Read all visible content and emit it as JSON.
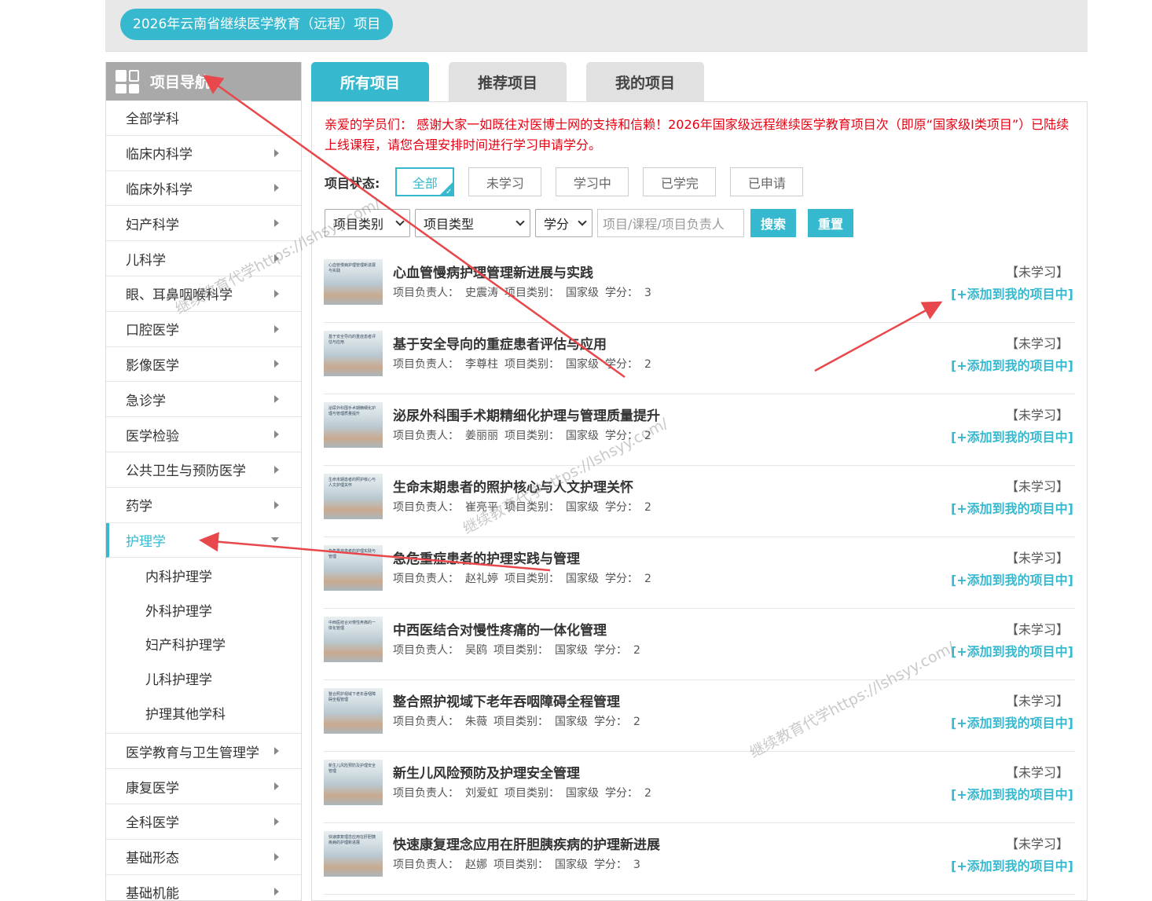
{
  "header": {
    "project_title": "2026年云南省继续医学教育（远程）项目"
  },
  "sidebar": {
    "title": "项目导航",
    "items": [
      {
        "label": "全部学科",
        "arrow": "none"
      },
      {
        "label": "临床内科学",
        "arrow": "right"
      },
      {
        "label": "临床外科学",
        "arrow": "right"
      },
      {
        "label": "妇产科学",
        "arrow": "right"
      },
      {
        "label": "儿科学",
        "arrow": "right"
      },
      {
        "label": "眼、耳鼻咽喉科学",
        "arrow": "right"
      },
      {
        "label": "口腔医学",
        "arrow": "right"
      },
      {
        "label": "影像医学",
        "arrow": "right"
      },
      {
        "label": "急诊学",
        "arrow": "right"
      },
      {
        "label": "医学检验",
        "arrow": "right"
      },
      {
        "label": "公共卫生与预防医学",
        "arrow": "right"
      },
      {
        "label": "药学",
        "arrow": "right"
      },
      {
        "label": "护理学",
        "arrow": "down",
        "active": true
      },
      {
        "label": "医学教育与卫生管理学",
        "arrow": "right"
      },
      {
        "label": "康复医学",
        "arrow": "right"
      },
      {
        "label": "全科医学",
        "arrow": "right"
      },
      {
        "label": "基础形态",
        "arrow": "right"
      },
      {
        "label": "基础机能",
        "arrow": "right"
      }
    ],
    "sub_items": [
      "内科护理学",
      "外科护理学",
      "妇产科护理学",
      "儿科护理学",
      "护理其他学科"
    ]
  },
  "tabs": [
    "所有项目",
    "推荐项目",
    "我的项目"
  ],
  "notice": "亲爱的学员们： 感谢大家一如既往对医博士网的支持和信赖！2026年国家级远程继续医学教育项目次（即原“国家级Ⅰ类项目”）已陆续上线课程，请您合理安排时间进行学习申请学分。",
  "status_filter": {
    "label": "项目状态:",
    "options": [
      "全部",
      "未学习",
      "学习中",
      "已学完",
      "已申请"
    ],
    "selected": "全部"
  },
  "filters": {
    "category": "项目类别",
    "type": "项目类型",
    "credit": "学分",
    "search_placeholder": "项目/课程/项目负责人",
    "search_button": "搜索",
    "reset_button": "重置"
  },
  "labels": {
    "owner": "项目负责人：",
    "category": "项目类别：",
    "credit": "学分：",
    "add": "[+添加到我的项目中]"
  },
  "courses": [
    {
      "thumb_text": "心血管慢病护理管理新进展与实践",
      "title": "心血管慢病护理管理新进展与实践",
      "owner": "史震涛",
      "category": "国家级",
      "credit": "3",
      "state": "【未学习】"
    },
    {
      "thumb_text": "基于安全导向的重症患者评估与应用",
      "title": "基于安全导向的重症患者评估与应用",
      "owner": "李尊柱",
      "category": "国家级",
      "credit": "2",
      "state": "【未学习】"
    },
    {
      "thumb_text": "泌尿外科围手术期精细化护理与管理质量提升",
      "title": "泌尿外科围手术期精细化护理与管理质量提升",
      "owner": "姜丽丽",
      "category": "国家级",
      "credit": "2",
      "state": "【未学习】"
    },
    {
      "thumb_text": "生命末期患者的照护核心与人文护理关怀",
      "title": "生命末期患者的照护核心与人文护理关怀",
      "owner": "崔亮平",
      "category": "国家级",
      "credit": "2",
      "state": "【未学习】"
    },
    {
      "thumb_text": "急危重症患者的护理实践与管理",
      "title": "急危重症患者的护理实践与管理",
      "owner": "赵礼婷",
      "category": "国家级",
      "credit": "2",
      "state": "【未学习】"
    },
    {
      "thumb_text": "中西医结合对慢性疼痛的一体化管理",
      "title": "中西医结合对慢性疼痛的一体化管理",
      "owner": "吴鸥",
      "category": "国家级",
      "credit": "2",
      "state": "【未学习】"
    },
    {
      "thumb_text": "整合照护视域下老年吞咽障碍全程管理",
      "title": "整合照护视域下老年吞咽障碍全程管理",
      "owner": "朱薇",
      "category": "国家级",
      "credit": "2",
      "state": "【未学习】"
    },
    {
      "thumb_text": "新生儿风险预防及护理安全管理",
      "title": "新生儿风险预防及护理安全管理",
      "owner": "刘爱虹",
      "category": "国家级",
      "credit": "2",
      "state": "【未学习】"
    },
    {
      "thumb_text": "快速康复理念应用在肝胆胰疾病的护理新进展",
      "title": "快速康复理念应用在肝胆胰疾病的护理新进展",
      "owner": "赵娜",
      "category": "国家级",
      "credit": "3",
      "state": "【未学习】"
    }
  ],
  "watermarks": [
    "继续教育代学https://lshsyy.com/",
    "继续教育代学https://lshsyy.com/",
    "继续教育代学https://lshsyy.com/"
  ],
  "colors": {
    "accent": "#36b9cf",
    "notice": "#e60012",
    "arrow": "#e8474b"
  }
}
